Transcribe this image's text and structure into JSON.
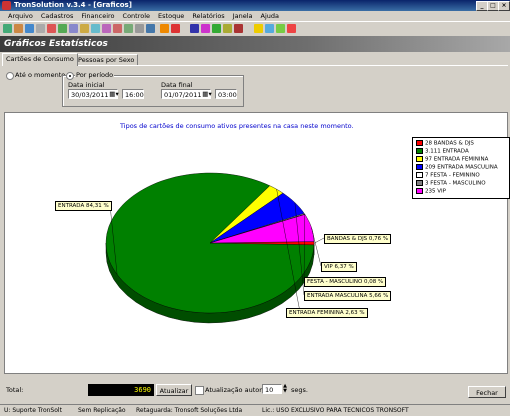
{
  "window": {
    "title": "TronSolution v.3.4 - [Graficos]",
    "controls": [
      "_",
      "□",
      "×"
    ]
  },
  "menu": [
    "Arquivo",
    "Cadastros",
    "Financeiro",
    "Controle",
    "Estoque",
    "Relatórios",
    "Janela",
    "Ajuda"
  ],
  "header": {
    "title": "Gráficos Estatísticos"
  },
  "tabs": [
    {
      "label": "Cartões de Consumo",
      "active": true
    },
    {
      "label": "Pessoas por Sexo",
      "active": false
    }
  ],
  "filters": {
    "until_now_label": "Até o momento",
    "by_period_label": "Por período",
    "start_label": "Data inicial",
    "start_date": "30/03/2011",
    "start_time": "16:00",
    "end_label": "Data final",
    "end_date": "01/07/2011",
    "end_time": "03:00",
    "selected": "by_period"
  },
  "colors": {
    "accent": "#3a6ea5",
    "chart_title": "#0000cc",
    "total_box": "#000000",
    "total_text": "#ffff00"
  },
  "chart_data": {
    "type": "pie",
    "title": "Tipos de cartões de consumo ativos presentes na casa neste momento.",
    "slices": [
      {
        "name": "BANDAS & DJS",
        "count": 28,
        "percent": 0.76,
        "label": "BANDAS & DJS 0,76 %",
        "color": "#ff0000"
      },
      {
        "name": "ENTRADA",
        "count": 3111,
        "percent": 84.31,
        "label": "ENTRADA 84,31 %",
        "color": "#008000"
      },
      {
        "name": "ENTRADA FEMININA",
        "count": 97,
        "percent": 2.63,
        "label": "ENTRADA FEMININA 2,63 %",
        "color": "#ffff00"
      },
      {
        "name": "ENTRADA MASCULINA",
        "count": 209,
        "percent": 5.66,
        "label": "ENTRADA MASCULINA 5,66 %",
        "color": "#0000ff"
      },
      {
        "name": "FESTA - FEMININO",
        "count": 7,
        "percent": 0.19,
        "label": "",
        "color": "#ffffff"
      },
      {
        "name": "FESTA - MASCULINO",
        "count": 3,
        "percent": 0.08,
        "label": "FESTA - MASCULINO 0,08 %",
        "color": "#808080"
      },
      {
        "name": "VIP",
        "count": 235,
        "percent": 6.37,
        "label": "VIP 6,37 %",
        "color": "#ff00ff"
      }
    ],
    "legend": [
      "28 BANDAS & DJS",
      "3.111 ENTRADA",
      "97 ENTRADA FEMININA",
      "209 ENTRADA MASCULINA",
      "7 FESTA - FEMININO",
      "3 FESTA - MASCULINO",
      "235 VIP"
    ],
    "legend_placement": "top-right"
  },
  "footer": {
    "total_label": "Total:",
    "total_value": "3690",
    "update_button": "Atualizar",
    "auto_update_label": "Atualização automática",
    "interval_value": "10",
    "interval_unit": "segs.",
    "close_button": "Fechar"
  },
  "status": {
    "user": "U: Suporte TronSolt",
    "replication": "Sem Replicação",
    "vendor": "Retaguarda: Tronsoft Soluções Ltda",
    "license": "Lic.: USO EXCLUSIVO PARA TECNICOS TRONSOFT"
  }
}
